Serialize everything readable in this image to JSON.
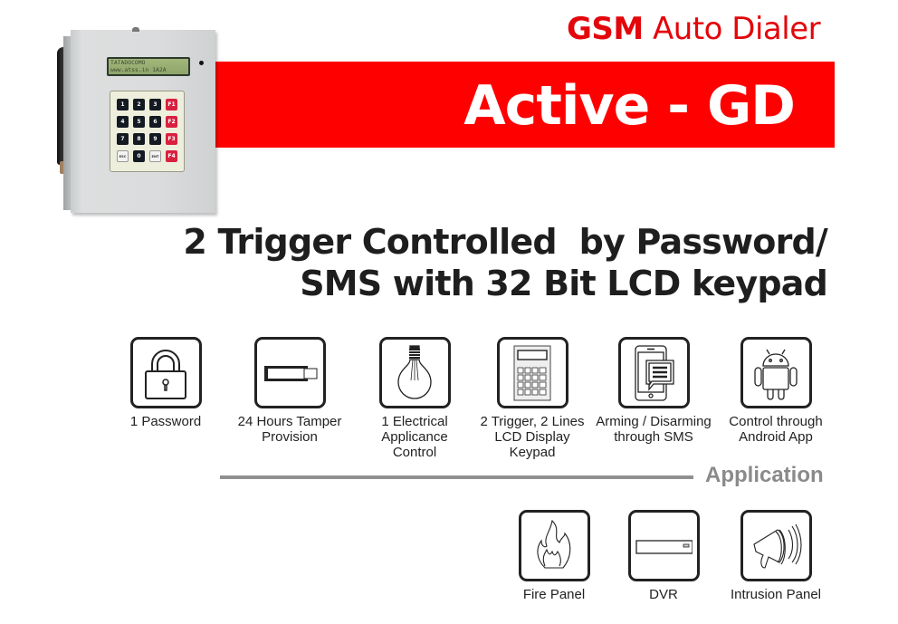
{
  "brand": {
    "bold": "GSM",
    "rest": " Auto Dialer",
    "color": "#e3060b"
  },
  "banner": {
    "title": "Active - GD",
    "color": "#fe0000"
  },
  "device": {
    "lcd_line1": "TATADOCOMO",
    "lcd_line2": "www.atss.in 1A2A",
    "keys": [
      "1",
      "2",
      "3",
      "F1",
      "4",
      "5",
      "6",
      "F2",
      "7",
      "8",
      "9",
      "F3",
      "ESC",
      "0",
      "ENT",
      "F4"
    ]
  },
  "headline": {
    "line1": "2 Trigger Controlled  by Password/",
    "line2": "SMS with 32 Bit LCD keypad"
  },
  "features": [
    {
      "icon": "padlock-icon",
      "label": "1 Password"
    },
    {
      "icon": "tamper-switch-icon",
      "label": "24 Hours Tamper\nProvision"
    },
    {
      "icon": "light-bulb-icon",
      "label": "1 Electrical\nApplicance\nControl"
    },
    {
      "icon": "lcd-keypad-icon",
      "label": "2 Trigger, 2 Lines\nLCD Display\nKeypad"
    },
    {
      "icon": "phone-sms-icon",
      "label": "Arming / Disarming\nthrough SMS"
    },
    {
      "icon": "android-icon",
      "label": "Control through\nAndroid App"
    }
  ],
  "application": {
    "heading": "Application",
    "items": [
      {
        "icon": "fire-icon",
        "label": "Fire Panel"
      },
      {
        "icon": "dvr-icon",
        "label": "DVR"
      },
      {
        "icon": "siren-speaker-icon",
        "label": "Intrusion Panel"
      }
    ]
  }
}
